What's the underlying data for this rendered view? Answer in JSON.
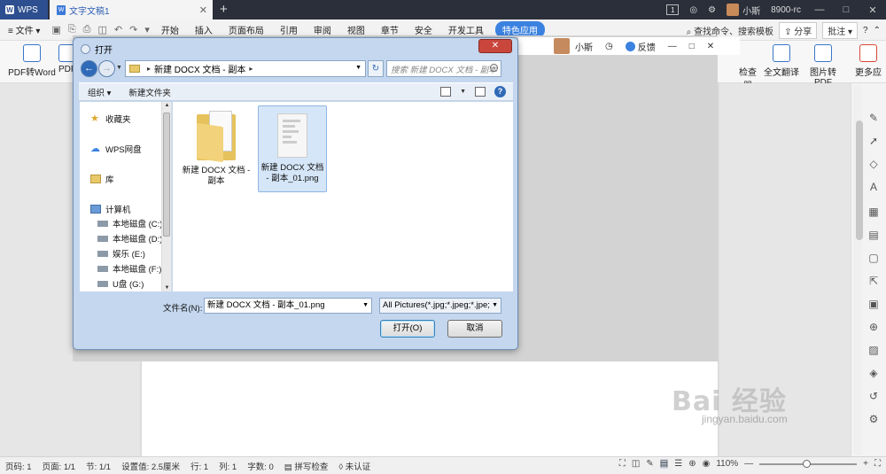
{
  "titlebar": {
    "app_tab": "WPS",
    "doc_tab": "文字文稿1",
    "new_tab": "+",
    "badge": "1",
    "user": "小斯",
    "user_code": "8900-rc",
    "min": "—",
    "max": "□",
    "close": "✕"
  },
  "menubar": {
    "file_menu": "文件",
    "items": [
      "开始",
      "插入",
      "页面布局",
      "引用",
      "审阅",
      "视图",
      "章节",
      "安全",
      "开发工具"
    ],
    "special": "特色应用",
    "search": "查找命令、搜索模板",
    "share": "分享",
    "review": "批注",
    "help": "?"
  },
  "ribbon": {
    "left_btn": "PDF转Word",
    "left_btn2": "PDF",
    "right_btns": [
      "检查器",
      "全文翻译",
      "图片转PDF",
      "更多应"
    ]
  },
  "host_strip": {
    "user": "小斯",
    "feedback": "反馈"
  },
  "dialog": {
    "title": "打开",
    "close": "✕",
    "path": [
      "新建 DOCX 文档 - 副本"
    ],
    "search_placeholder": "搜索 新建 DOCX 文档 - 副本",
    "toolbar": {
      "organize": "组织 ▾",
      "new_folder": "新建文件夹"
    },
    "nav": {
      "favorites": "收藏夹",
      "wps_cloud": "WPS网盘",
      "library": "库",
      "computer": "计算机",
      "drives": [
        "本地磁盘 (C:)",
        "本地磁盘 (D:)",
        "娱乐 (E:)",
        "本地磁盘 (F:)",
        "U盘 (G:)"
      ]
    },
    "files": [
      {
        "name": "新建 DOCX 文档 - 副本",
        "type": "folder",
        "selected": false
      },
      {
        "name": "新建 DOCX 文档 - 副本_01.png",
        "type": "png",
        "selected": true
      }
    ],
    "filename_label": "文件名(N):",
    "filename_value": "新建 DOCX 文档 - 副本_01.png",
    "filter_value": "All Pictures(*.jpg;*.jpeg;*.jpe;",
    "open_btn": "打开(O)",
    "cancel_btn": "取消"
  },
  "statusbar": {
    "page_num": "页码: 1",
    "pages": "页面: 1/1",
    "section": "节: 1/1",
    "setting": "设置值: 2.5厘米",
    "row": "行: 1",
    "col": "列: 1",
    "words": "字数: 0",
    "spell": "拼写检查",
    "cert": "未认证",
    "zoom": "110%",
    "zoom_fraction": 0.48
  },
  "watermark": {
    "text": "Bai 经验",
    "url": "jingyan.baidu.com"
  }
}
